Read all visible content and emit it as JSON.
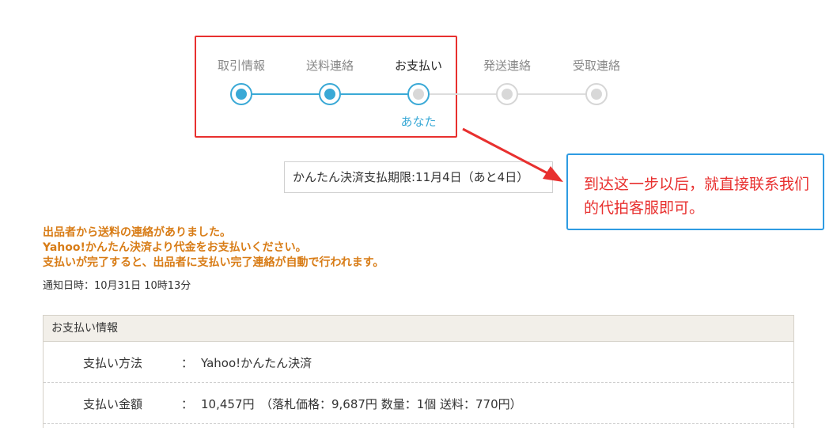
{
  "steps": [
    {
      "label": "取引情報",
      "state": "done"
    },
    {
      "label": "送料連絡",
      "state": "done"
    },
    {
      "label": "お支払い",
      "state": "current"
    },
    {
      "label": "発送連絡",
      "state": "todo"
    },
    {
      "label": "受取連絡",
      "state": "todo"
    }
  ],
  "current_actor_label": "あなた",
  "deadline_text": "かんたん決済支払期限:11月4日（あと4日）",
  "callout_text": "到达这一步以后，就直接联系我们的代拍客服即可。",
  "notice_lines": [
    "出品者から送料の連絡がありました。",
    "Yahoo!かんたん決済より代金をお支払いください。",
    "支払いが完了すると、出品者に支払い完了連絡が自動で行われます。"
  ],
  "notify_time": "通知日時：10月31日 10時13分",
  "payment_info": {
    "title": "お支払い情報",
    "rows": [
      {
        "label": "支払い方法",
        "value": "Yahoo!かんたん決済"
      },
      {
        "label": "支払い金額",
        "value": "10,457円　（落札価格：9,687円 数量：1個 送料：770円）"
      }
    ]
  },
  "colors": {
    "step_active": "#3aa9d6",
    "step_inactive": "#d6d6d6",
    "annotation_red": "#e8302f",
    "callout_border": "#2e9be2",
    "notice_orange": "#d87c16"
  }
}
